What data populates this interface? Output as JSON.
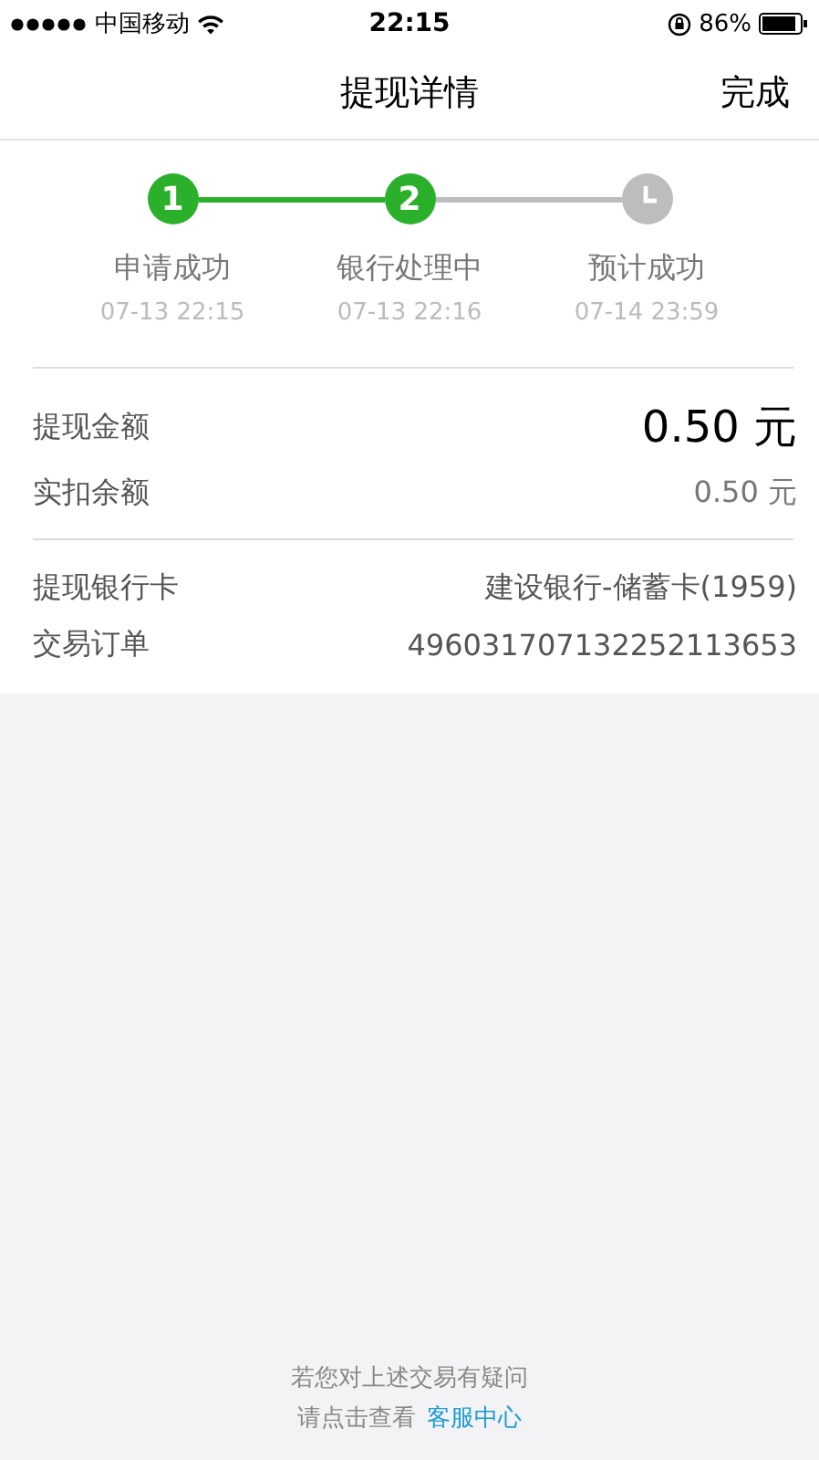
{
  "status_bar": {
    "carrier": "中国移动",
    "time": "22:15",
    "battery": "86%"
  },
  "nav": {
    "title": "提现详情",
    "action": "完成"
  },
  "steps": [
    {
      "kind": "number",
      "marker": "1",
      "done": true,
      "label": "申请成功",
      "time": "07-13 22:15"
    },
    {
      "kind": "number",
      "marker": "2",
      "done": true,
      "label": "银行处理中",
      "time": "07-13 22:16"
    },
    {
      "kind": "pending",
      "done": false,
      "label": "预计成功",
      "time": "07-14 23:59"
    }
  ],
  "amounts": [
    {
      "kind": "main",
      "label": "提现金额",
      "value": "0.50 元"
    },
    {
      "kind": "minor",
      "label": "实扣余额",
      "value": "0.50 元"
    }
  ],
  "details": [
    {
      "label": "提现银行卡",
      "value": "建设银行-储蓄卡(1959)"
    },
    {
      "label": "交易订单",
      "value": "496031707132252113653"
    }
  ],
  "footer": {
    "question": "若您对上述交易有疑问",
    "prompt": "请点击查看",
    "link": "客服中心"
  }
}
